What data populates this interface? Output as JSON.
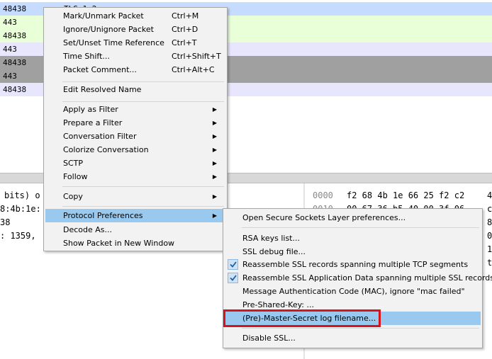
{
  "packet_list": {
    "rows": [
      {
        "port": "48438",
        "frag": "TLSv1.2",
        "bg": "#c6dcff"
      },
      {
        "port": "443",
        "frag": "",
        "bg": "#e9ffd8"
      },
      {
        "port": "48438",
        "frag": "",
        "bg": "#e9ffd8"
      },
      {
        "port": "443",
        "frag": "",
        "bg": "#e8e6fc"
      },
      {
        "port": "48438",
        "frag": "",
        "bg": "#a0a0a0"
      },
      {
        "port": "443",
        "frag": "",
        "bg": "#a0a0a0"
      },
      {
        "port": "48438",
        "frag": "",
        "bg": "#e8e6fc"
      }
    ]
  },
  "detail_pane": {
    "lines": [
      "bits) o",
      "8:4b:1e:",
      "38",
      ": 1359,"
    ]
  },
  "bytes_pane": {
    "rows": [
      {
        "offset": "0000",
        "hex": "f2 68 4b 1e 66 25 f2 c2",
        "right": "4"
      },
      {
        "offset": "0010",
        "hex": "00 67 36 b5 40 00 3f 06",
        "right": "c"
      },
      {
        "offset": "",
        "hex": "",
        "right": "8"
      },
      {
        "offset": "",
        "hex": "",
        "right": "0"
      },
      {
        "offset": "",
        "hex": "",
        "right": "1"
      },
      {
        "offset": "",
        "hex": "",
        "right": "t"
      }
    ]
  },
  "context_menu": {
    "items": [
      {
        "label": "Mark/Unmark Packet",
        "shortcut": "Ctrl+M"
      },
      {
        "label": "Ignore/Unignore Packet",
        "shortcut": "Ctrl+D"
      },
      {
        "label": "Set/Unset Time Reference",
        "shortcut": "Ctrl+T"
      },
      {
        "label": "Time Shift...",
        "shortcut": "Ctrl+Shift+T"
      },
      {
        "label": "Packet Comment...",
        "shortcut": "Ctrl+Alt+C"
      },
      {
        "label": "Edit Resolved Name"
      },
      {
        "label": "Apply as Filter"
      },
      {
        "label": "Prepare a Filter"
      },
      {
        "label": "Conversation Filter"
      },
      {
        "label": "Colorize Conversation"
      },
      {
        "label": "SCTP"
      },
      {
        "label": "Follow"
      },
      {
        "label": "Copy"
      },
      {
        "label": "Protocol Preferences"
      },
      {
        "label": "Decode As..."
      },
      {
        "label": "Show Packet in New Window"
      }
    ]
  },
  "protocol_prefs_submenu": {
    "items": [
      {
        "label": "Open Secure Sockets Layer preferences..."
      },
      {
        "label": "RSA keys list..."
      },
      {
        "label": "SSL debug file..."
      },
      {
        "label": "Reassemble SSL records spanning multiple TCP segments",
        "checked": true
      },
      {
        "label": "Reassemble SSL Application Data spanning multiple SSL records",
        "checked": true
      },
      {
        "label": "Message Authentication Code (MAC), ignore \"mac failed\""
      },
      {
        "label": "Pre-Shared-Key: ..."
      },
      {
        "label": "(Pre)-Master-Secret log filename..."
      },
      {
        "label": "Disable SSL..."
      }
    ]
  },
  "colors": {
    "highlight": "#99c9ef",
    "callout_red": "#d6141a",
    "menu_bg": "#f2f2f2"
  }
}
